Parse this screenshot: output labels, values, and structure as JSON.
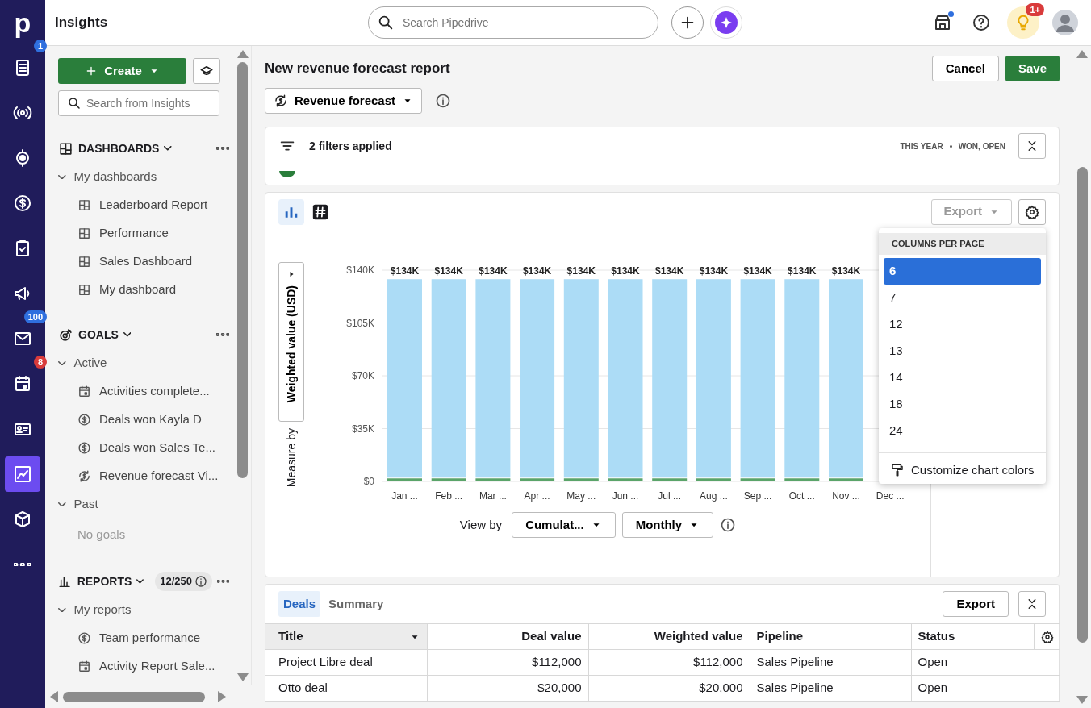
{
  "app": {
    "logo": "p",
    "title": "Insights"
  },
  "rail": [
    {
      "selected": false,
      "badge": {
        "text": "1",
        "color": "#2f6fde"
      }
    },
    {
      "selected": false
    },
    {
      "selected": false
    },
    {
      "selected": false
    },
    {
      "selected": false
    },
    {
      "selected": false
    },
    {
      "selected": false,
      "badge": {
        "text": "100",
        "color": "#2f6fde"
      }
    },
    {
      "selected": false,
      "badge": {
        "text": "8",
        "color": "#d93b3b"
      }
    },
    {
      "selected": false
    },
    {
      "selected": true
    },
    {
      "selected": false
    },
    {
      "selected": false
    }
  ],
  "search": {
    "placeholder": "Search Pipedrive"
  },
  "tips_badge": "1+",
  "sidebar": {
    "create": "Create",
    "search_placeholder": "Search from Insights",
    "sections": [
      {
        "title": "DASHBOARDS",
        "kind": "dashboards",
        "groups": [
          {
            "label": "My dashboards",
            "expanded": true,
            "items": [
              {
                "label": "Leaderboard Report",
                "kind": "dashboard"
              },
              {
                "label": "Performance",
                "kind": "dashboard"
              },
              {
                "label": "Sales Dashboard",
                "kind": "dashboard"
              },
              {
                "label": "My dashboard",
                "kind": "dashboard"
              }
            ]
          }
        ]
      },
      {
        "title": "GOALS",
        "kind": "goals",
        "groups": [
          {
            "label": "Active",
            "expanded": true,
            "items": [
              {
                "label": "Activities complete...",
                "kind": "activity"
              },
              {
                "label": "Deals won Kayla D",
                "kind": "deal"
              },
              {
                "label": "Deals won Sales Te...",
                "kind": "deal"
              },
              {
                "label": "Revenue forecast Vi...",
                "kind": "revenue"
              }
            ]
          },
          {
            "label": "Past",
            "expanded": true,
            "empty": "No goals"
          }
        ]
      },
      {
        "title": "REPORTS",
        "kind": "reports",
        "count": "12/250",
        "groups": [
          {
            "label": "My reports",
            "expanded": true,
            "items": [
              {
                "label": "Team performance",
                "kind": "deal"
              },
              {
                "label": "Activity Report Sale...",
                "kind": "activity"
              }
            ]
          }
        ]
      }
    ]
  },
  "report": {
    "title": "New revenue forecast report",
    "cancel": "Cancel",
    "save": "Save",
    "type": "Revenue forecast",
    "filters": {
      "label": "2 filters applied",
      "period": "THIS YEAR",
      "status": "WON, OPEN"
    },
    "views": [
      {
        "kind": "bars",
        "selected": true
      },
      {
        "kind": "number",
        "selected": false
      }
    ],
    "export": {
      "label": "Export",
      "disabled": true
    },
    "measure_by": {
      "label": "Measure by",
      "value": "Weighted value (USD)"
    },
    "chart_data": {
      "type": "bar",
      "stacked": true,
      "categories": [
        "Jan ...",
        "Feb ...",
        "Mar ...",
        "Apr ...",
        "May ...",
        "Jun ...",
        "Jul ...",
        "Aug ...",
        "Sep ...",
        "Oct ...",
        "Nov ...",
        "Dec ..."
      ],
      "series": [
        {
          "color": "#5aa469",
          "values": [
            2000,
            2000,
            2000,
            2000,
            2000,
            2000,
            2000,
            2000,
            2000,
            2000,
            2000,
            null
          ]
        },
        {
          "color": "#acdcf6",
          "values": [
            132000,
            132000,
            132000,
            132000,
            132000,
            132000,
            132000,
            132000,
            132000,
            132000,
            132000,
            null
          ]
        }
      ],
      "grid": true,
      "ylim": [
        0,
        140000
      ],
      "yticks": [
        {
          "value": 0,
          "label": "$0"
        },
        {
          "value": 35000,
          "label": "$35K"
        },
        {
          "value": 70000,
          "label": "$70K"
        },
        {
          "value": 105000,
          "label": "$105K"
        },
        {
          "value": 140000,
          "label": "$140K"
        }
      ],
      "value_labels": [
        "$134K",
        "$134K",
        "$134K",
        "$134K",
        "$134K",
        "$134K",
        "$134K",
        "$134K",
        "$134K",
        "$134K",
        "$134K",
        null
      ]
    },
    "view_by": {
      "label": "View by",
      "options": [
        "Cumulat...",
        "Monthly"
      ]
    },
    "columns_menu": {
      "title": "COLUMNS PER PAGE",
      "options": [
        {
          "label": "6",
          "selected": true
        },
        {
          "label": "7",
          "selected": false
        },
        {
          "label": "12",
          "selected": false
        },
        {
          "label": "13",
          "selected": false
        },
        {
          "label": "14",
          "selected": false
        },
        {
          "label": "18",
          "selected": false
        },
        {
          "label": "24",
          "selected": false
        }
      ],
      "action": "Customize chart colors"
    }
  },
  "table": {
    "tabs": [
      {
        "label": "Deals",
        "selected": true
      },
      {
        "label": "Summary",
        "selected": false
      }
    ],
    "export": "Export",
    "columns": [
      {
        "label": "Title",
        "kind": "text",
        "sorted": true
      },
      {
        "label": "Deal value",
        "kind": "number",
        "sorted": false
      },
      {
        "label": "Weighted value",
        "kind": "number",
        "sorted": false
      },
      {
        "label": "Pipeline",
        "kind": "text",
        "sorted": false
      },
      {
        "label": "Status",
        "kind": "text",
        "sorted": false
      }
    ],
    "rows": [
      [
        "Project Libre deal",
        "$112,000",
        "$112,000",
        "Sales Pipeline",
        "Open"
      ],
      [
        "Otto deal",
        "$20,000",
        "$20,000",
        "Sales Pipeline",
        "Open"
      ]
    ]
  }
}
